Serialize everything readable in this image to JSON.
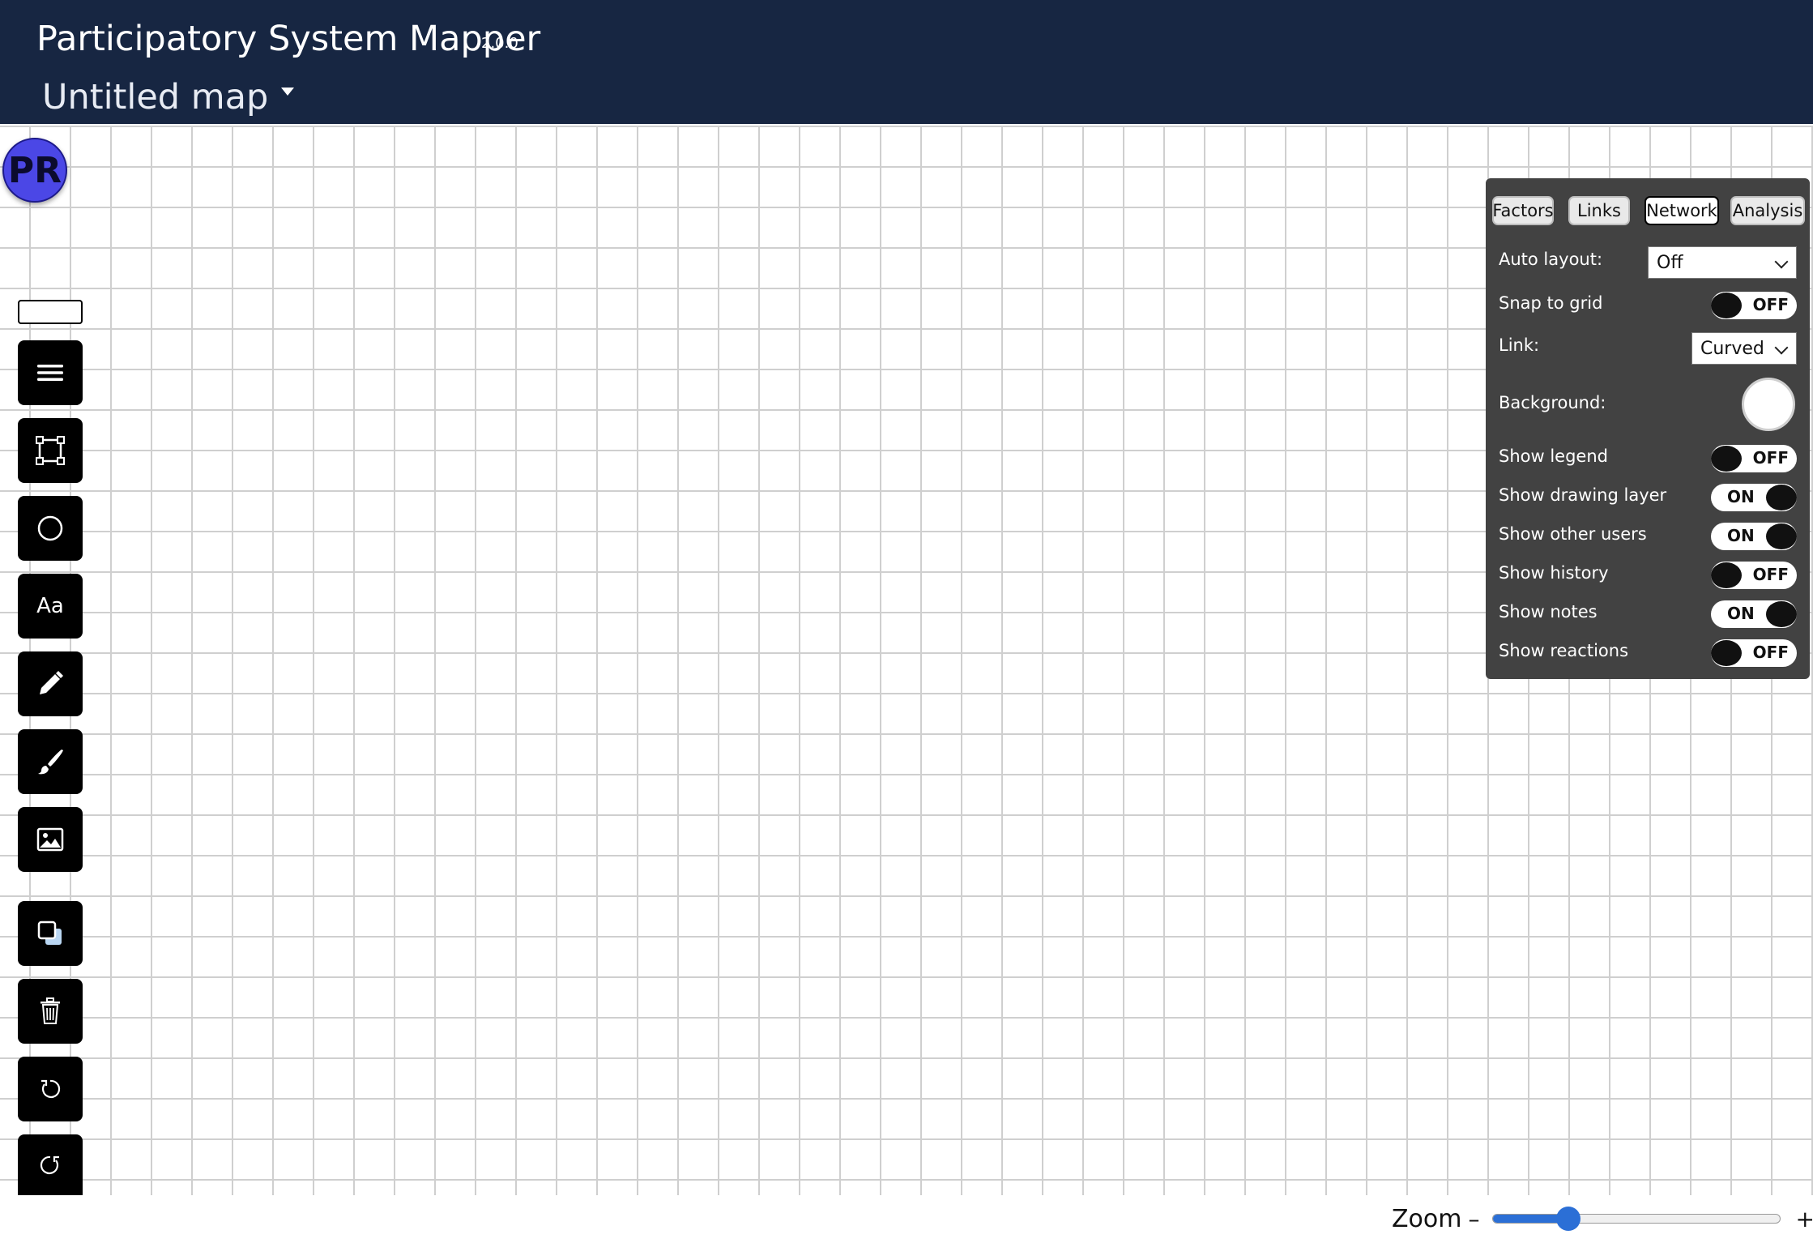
{
  "header": {
    "app_title": "Participatory System Mapper",
    "version": "2.0.0",
    "map_title": "Untitled map"
  },
  "avatar": {
    "initials": "PR",
    "color": "#4b47e6"
  },
  "toolbar": {
    "items": [
      {
        "name": "menu",
        "icon": "hamburger-icon"
      },
      {
        "name": "rectangle",
        "icon": "rectangle-select-icon"
      },
      {
        "name": "circle",
        "icon": "circle-icon"
      },
      {
        "name": "text",
        "icon": "text-icon",
        "label": "Aa"
      },
      {
        "name": "pencil",
        "icon": "pencil-icon"
      },
      {
        "name": "brush",
        "icon": "brush-icon"
      },
      {
        "name": "image",
        "icon": "image-icon"
      },
      {
        "name": "duplicate",
        "icon": "duplicate-icon"
      },
      {
        "name": "delete",
        "icon": "trash-icon"
      },
      {
        "name": "undo",
        "icon": "undo-icon"
      },
      {
        "name": "redo",
        "icon": "redo-icon"
      }
    ]
  },
  "panel": {
    "tabs": [
      "Factors",
      "Links",
      "Network",
      "Analysis"
    ],
    "active_tab": "Network",
    "auto_layout": {
      "label": "Auto layout:",
      "value": "Off"
    },
    "snap_to_grid": {
      "label": "Snap to grid",
      "state": "OFF"
    },
    "link": {
      "label": "Link:",
      "value": "Curved"
    },
    "background": {
      "label": "Background:",
      "color": "#ffffff"
    },
    "toggles": [
      {
        "label": "Show legend",
        "state": "OFF"
      },
      {
        "label": "Show drawing layer",
        "state": "ON"
      },
      {
        "label": "Show other users",
        "state": "ON"
      },
      {
        "label": "Show history",
        "state": "OFF"
      },
      {
        "label": "Show notes",
        "state": "ON"
      },
      {
        "label": "Show reactions",
        "state": "OFF"
      }
    ]
  },
  "zoom": {
    "label": "Zoom",
    "minus": "–",
    "plus": "+",
    "level": 0.26
  },
  "colors": {
    "header_bg": "#172642",
    "panel_bg": "#424242",
    "accent": "#2b6fd6"
  }
}
